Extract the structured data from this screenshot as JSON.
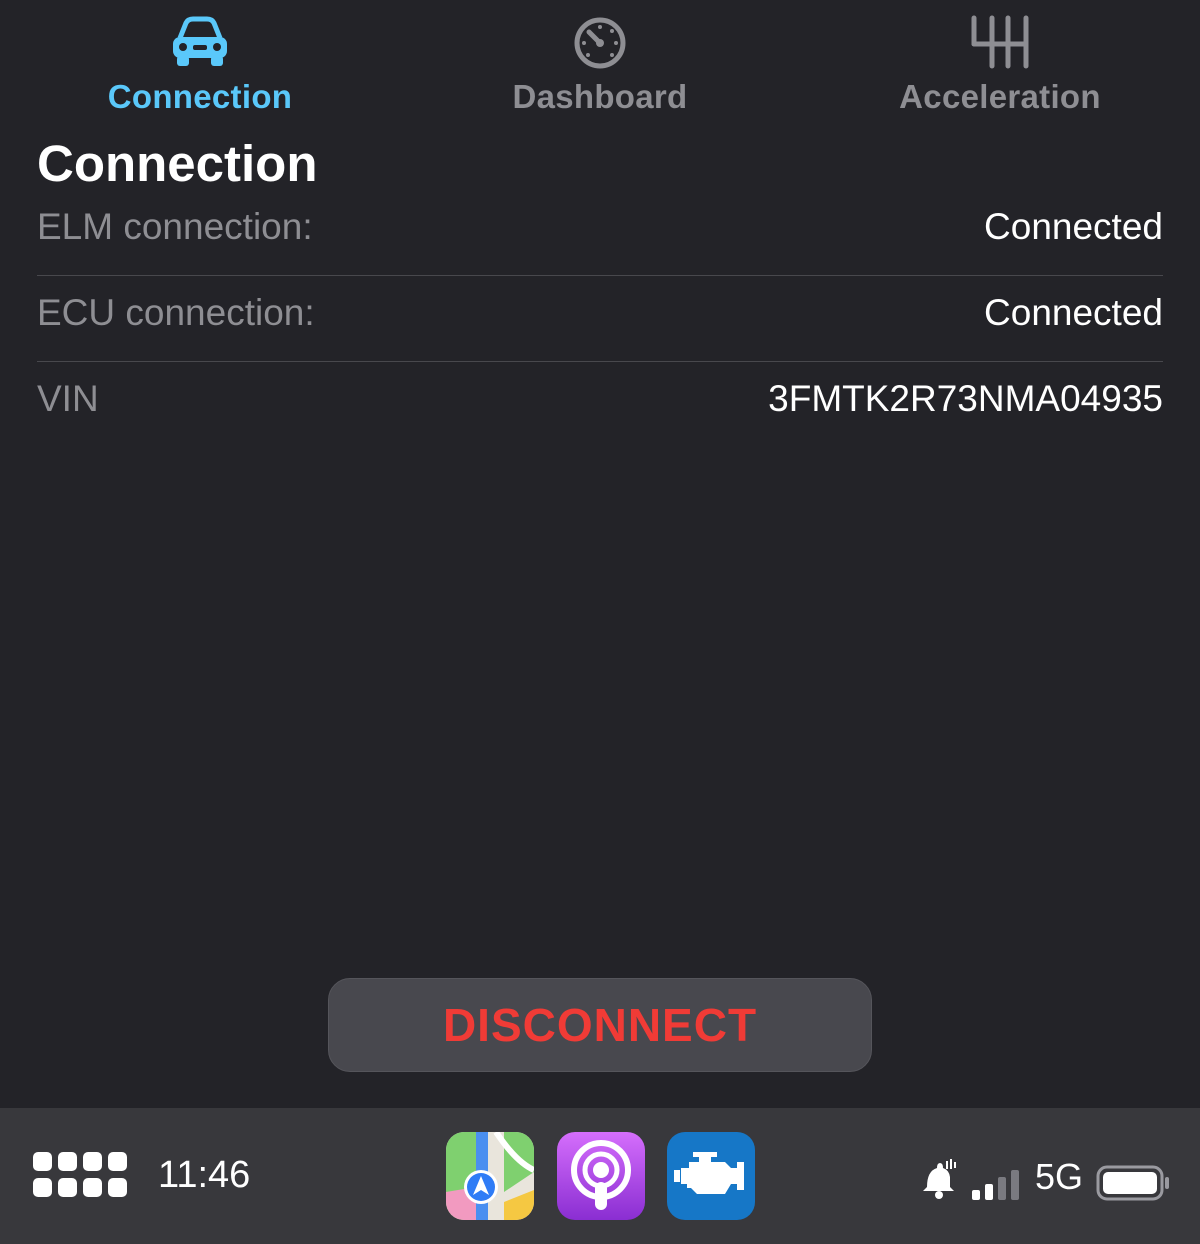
{
  "tabs": [
    {
      "label": "Connection",
      "icon": "car-icon",
      "active": true
    },
    {
      "label": "Dashboard",
      "icon": "speedometer-icon",
      "active": false
    },
    {
      "label": "Acceleration",
      "icon": "gear-shifter-icon",
      "active": false
    }
  ],
  "page": {
    "title": "Connection",
    "rows": [
      {
        "label": "ELM connection:",
        "value": "Connected"
      },
      {
        "label": "ECU connection:",
        "value": "Connected"
      },
      {
        "label": "VIN",
        "value": "3FMTK2R73NMA04935"
      }
    ],
    "disconnect_label": "DISCONNECT"
  },
  "carplay": {
    "time": "11:46",
    "apps": [
      "maps-app-icon",
      "podcasts-app-icon",
      "obd-engine-app-icon"
    ],
    "network": "5G"
  },
  "colors": {
    "accent": "#5ac8fa",
    "inactive": "#8e8e93",
    "destructive": "#f03b36",
    "background": "#232328"
  }
}
